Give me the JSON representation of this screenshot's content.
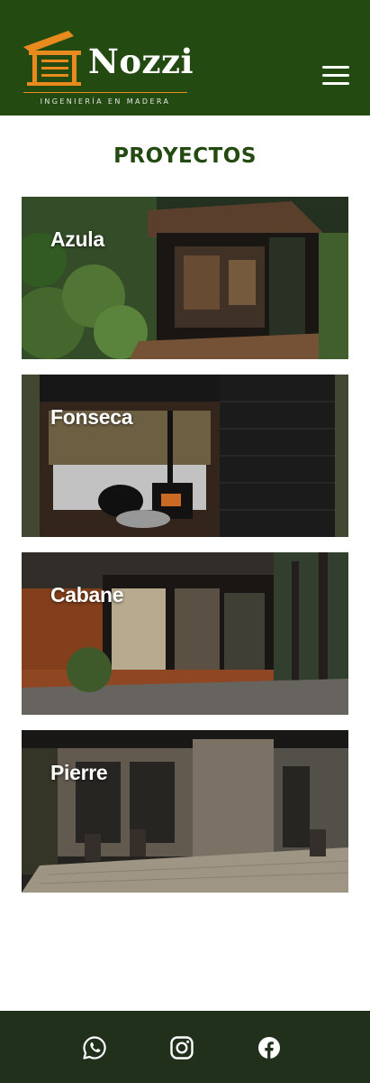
{
  "header": {
    "brand_name": "Nozzi",
    "tagline": "INGENIERÍA EN MADERA",
    "logo_icon": "house-frame-icon",
    "menu_icon": "hamburger-menu-icon"
  },
  "colors": {
    "header_bg": "#234a10",
    "accent_orange": "#e98a1e",
    "title_green": "#234a10",
    "footer_bg": "#20301b"
  },
  "main": {
    "section_title": "PROYECTOS",
    "projects": [
      {
        "name": "Azula"
      },
      {
        "name": "Fonseca"
      },
      {
        "name": "Cabane"
      },
      {
        "name": "Pierre"
      }
    ]
  },
  "footer": {
    "social": [
      {
        "icon": "whatsapp-icon"
      },
      {
        "icon": "instagram-icon"
      },
      {
        "icon": "facebook-icon"
      }
    ]
  }
}
